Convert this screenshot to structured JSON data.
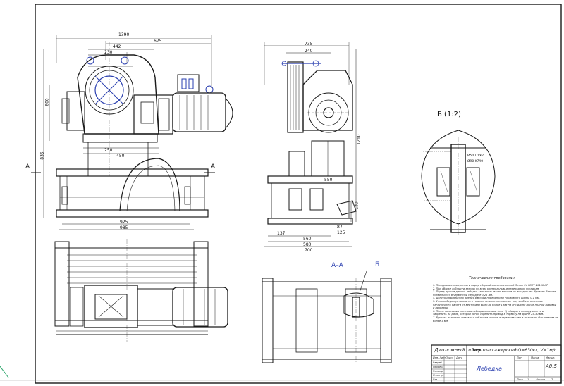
{
  "dims": {
    "d1390": "1390",
    "d675": "675",
    "d442": "442",
    "d230": "230",
    "d250": "250",
    "d450": "450",
    "d925": "925",
    "d985": "985",
    "d835": "835",
    "d600": "600",
    "d735": "735",
    "d240": "240",
    "d1260": "1260",
    "d550": "550",
    "d130": "130",
    "d137": "137",
    "d560": "560",
    "d580": "580",
    "d700": "700",
    "d87": "87",
    "d125": "125"
  },
  "labels": {
    "section_a_left": "A",
    "section_a_right": "A",
    "section_aa": "A–A",
    "detail_b": "Б (1:2)",
    "marker_b": "Б",
    "fit1": "Ø50 L0/k7",
    "fit2": "Ø90 K7/l0"
  },
  "notes": {
    "title": "Технические требования",
    "items": [
      "1. Посадочные поверхности перед сборкой смазать смазкой Литол 24 ГОСТ 21150-87",
      "2. При сборке соблюсти зазоры по всем контрольным и переходным посадкам.",
      "3. Перед пуском данной лебедки заполнить масло маслом по инструкции. Уровень 8 после нормального в червячной передаче 0,25 мм.",
      "4. Допуск радиального биения рабочей поверхности тормозного шкива 0,1 мм.",
      "5. Узлы лебедки установить в горизонтальное положение так, чтобы отклонение нагрузочного каната от вертикали было не более 1 мм на его длине после полной набивки и проверки.",
      "6. После окончания монтажа лебедки шпильки (поз. 1) обварить по окружности и закрепить на раме, которой затем скрепить привод к тормозу на длине 25-30 мм.",
      "7. Рукоять полостью смазать и соблюсти полное и герметизацию в полостях. Отклонение не более 3 мм."
    ]
  },
  "title_block": {
    "project": "Дипломный проект",
    "subject": "Лифт пассажирский Q=630кг, V=1м/с",
    "drawing": "Лебедка",
    "sheet_code": "А0.5",
    "col_lit": "Лит.",
    "col_mass": "Масса",
    "col_scale": "Масшт.",
    "sheet_label": "Лист",
    "sheets_label": "Листов",
    "sheet_num": "1",
    "sheet_total": "2",
    "role_dev": "Разраб.",
    "role_check": "Провер.",
    "role_tcontrol": "Т.контр.",
    "role_ncontrol": "Н.контр.",
    "role_approve": "Утв.",
    "col_sign": "Подп.",
    "col_date": "Дата",
    "format_label": "Изм. Лист"
  },
  "colors": {
    "line": "#1a1a1a",
    "accent_blue": "#2a3fb0",
    "frame_green": "#2aa56a"
  }
}
